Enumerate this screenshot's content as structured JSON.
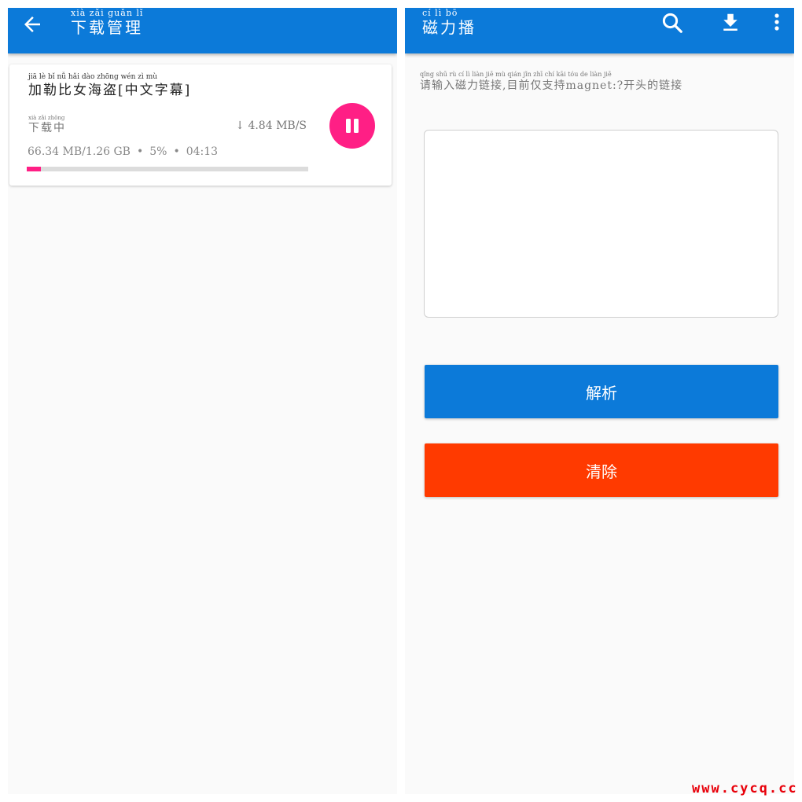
{
  "colors": {
    "primary": "#0c7ad9",
    "accent": "#ff1f85",
    "danger": "#ff3a00",
    "background": "#fafafa",
    "watermark": "#e8000a"
  },
  "left": {
    "appbar": {
      "back_icon": "arrow-left-icon",
      "title_pinyin": "xià zǎi guǎn lǐ",
      "title": "下载管理"
    },
    "download": {
      "title_pinyin": "jiā lè bǐ nǚ hǎi dào zhōng wén zì mù",
      "title": "加勒比女海盗[中文字幕]",
      "status_pinyin": "xià zǎi zhōng",
      "status": "下载中",
      "speed": "↓ 4.84 MB/S",
      "size": "66.34 MB/1.26 GB",
      "percent_label": "5%",
      "eta": "04:13",
      "progress": 0.05,
      "pause_icon": "pause-icon"
    }
  },
  "right": {
    "appbar": {
      "title_pinyin": "cí lì bō",
      "title": "磁力播",
      "search_icon": "search-icon",
      "download_icon": "download-icon",
      "more_icon": "more-vertical-icon"
    },
    "hint_pinyin": "qǐng shū rù cí lì liàn jiē mù qián jǐn zhī chí  kāi tóu de liàn jiē",
    "hint": "请输入磁力链接,目前仅支持magnet:?开头的链接",
    "input_value": "",
    "parse_label": "解析",
    "clear_label": "清除"
  },
  "watermark": "www.cycq.cc"
}
